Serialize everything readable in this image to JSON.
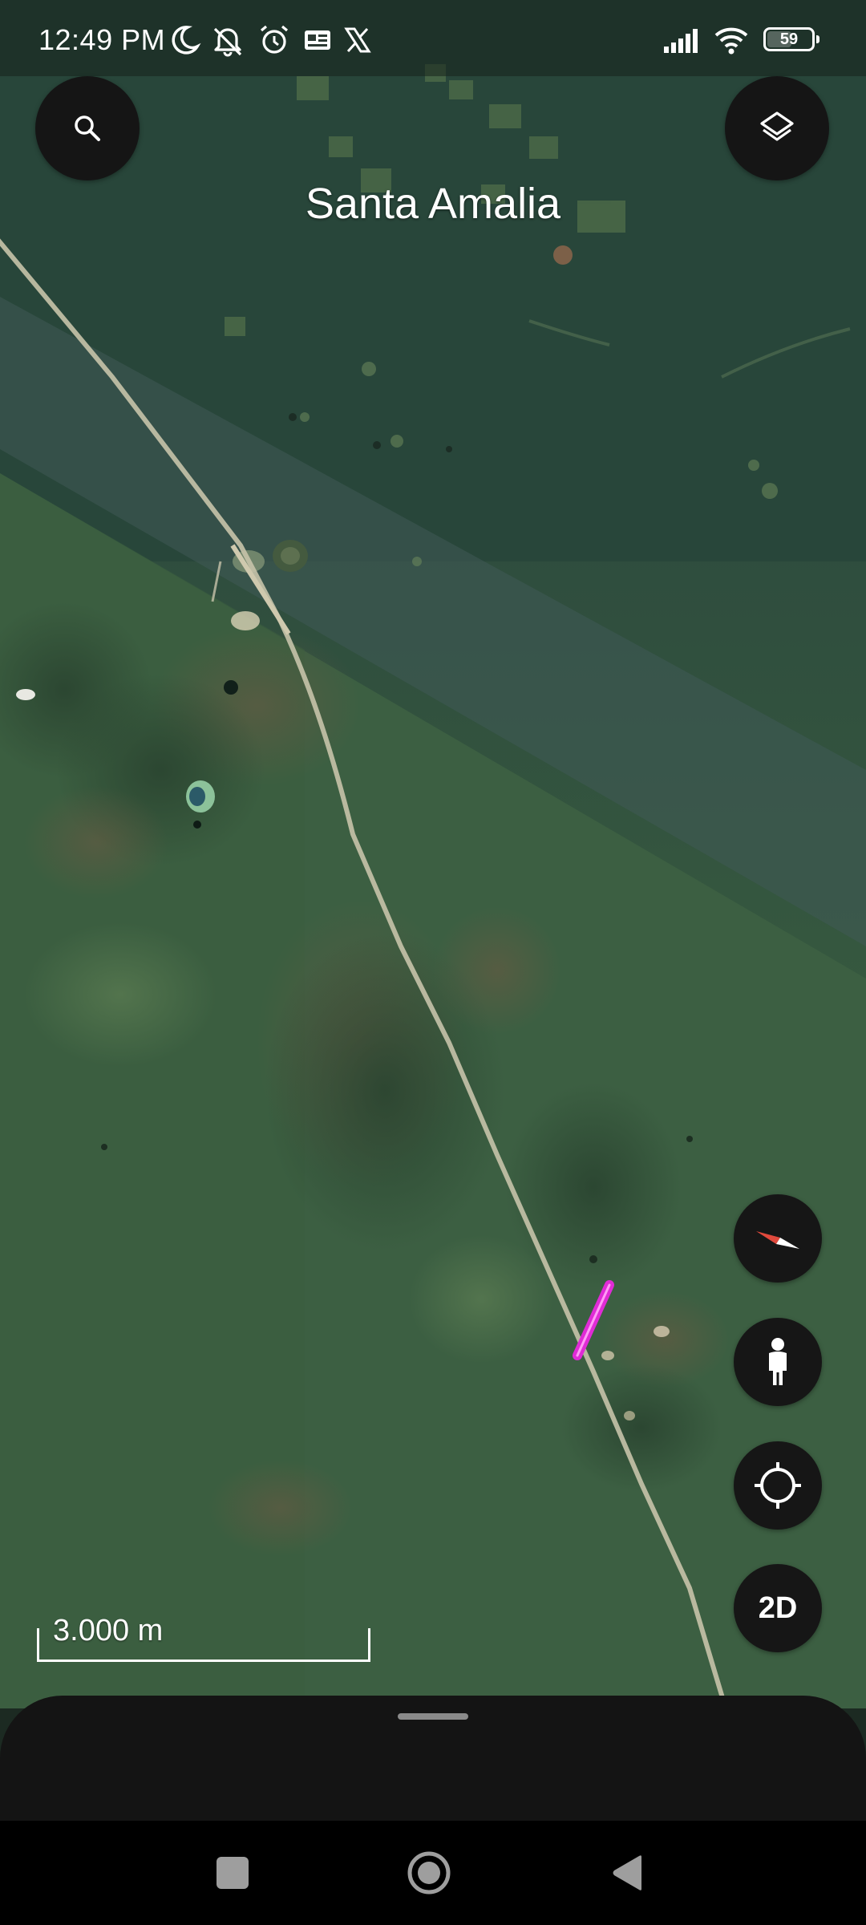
{
  "status_bar": {
    "time": "12:49 PM",
    "icons": [
      "moon-icon",
      "bell-off-icon",
      "alarm-icon",
      "sim-card-icon",
      "x-logo-icon"
    ],
    "right_icons": [
      "signal-icon",
      "wifi-icon",
      "battery-icon"
    ],
    "battery_percent": "59",
    "battery_level": 0.59
  },
  "map": {
    "place_label": "Santa Amalia",
    "scale_label": "3.000 m",
    "accent_color": "#e02bd6"
  },
  "top_controls": {
    "search_icon": "search-icon",
    "layers_icon": "layers-icon"
  },
  "side_controls": {
    "compass_icon": "compass-icon",
    "street_view_icon": "pegman-icon",
    "my_location_icon": "my-location-icon",
    "view_mode_label": "2D"
  },
  "bottom_sheet": {
    "handle": "drag-handle"
  },
  "nav_bar": {
    "recents_icon": "square-icon",
    "home_icon": "circle-icon",
    "back_icon": "triangle-back-icon"
  }
}
